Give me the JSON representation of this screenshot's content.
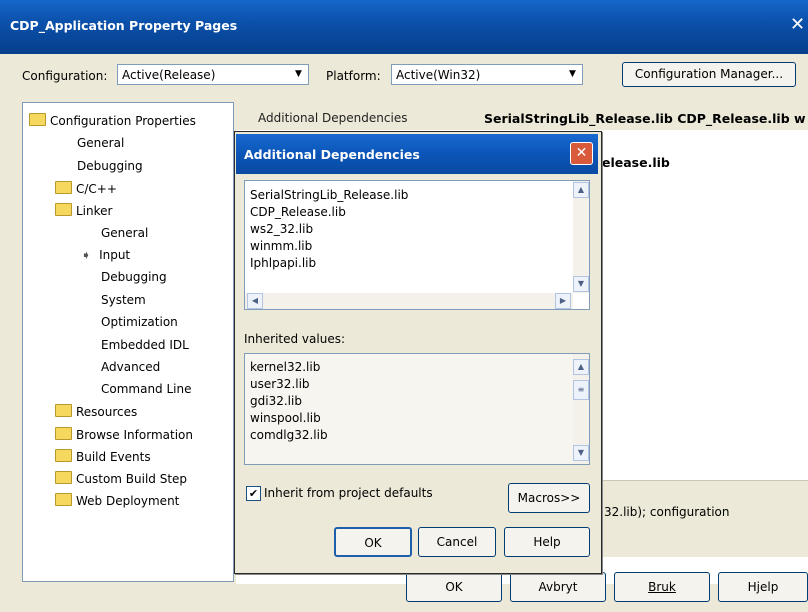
{
  "window": {
    "title": "CDP_Application Property Pages",
    "close_glyph": "✕"
  },
  "toolbar": {
    "configuration_label": "Configuration:",
    "configuration_value": "Active(Release)",
    "platform_label": "Platform:",
    "platform_value": "Active(Win32)",
    "config_manager_label": "Configuration Manager..."
  },
  "tree": {
    "items": [
      {
        "label": "Configuration Properties"
      },
      {
        "label": "General"
      },
      {
        "label": "Debugging"
      },
      {
        "label": "C/C++"
      },
      {
        "label": "Linker"
      },
      {
        "label": "General"
      },
      {
        "label": "Input"
      },
      {
        "label": "Debugging"
      },
      {
        "label": "System"
      },
      {
        "label": "Optimization"
      },
      {
        "label": "Embedded IDL"
      },
      {
        "label": "Advanced"
      },
      {
        "label": "Command Line"
      },
      {
        "label": "Resources"
      },
      {
        "label": "Browse Information"
      },
      {
        "label": "Build Events"
      },
      {
        "label": "Custom Build Step"
      },
      {
        "label": "Web Deployment"
      }
    ]
  },
  "grid": {
    "row0_name": "Additional Dependencies",
    "row0_value": "SerialStringLib_Release.lib CDP_Release.lib w",
    "row1_value": "elease.lib"
  },
  "description": {
    "text": "32.lib); configuration"
  },
  "footer": {
    "ok": "OK",
    "cancel": "Avbryt",
    "apply": "Bruk",
    "help": "Hjelp"
  },
  "dialog": {
    "title": "Additional Dependencies",
    "close_glyph": "✕",
    "deps": [
      "SerialStringLib_Release.lib",
      "CDP_Release.lib",
      "ws2_32.lib",
      "winmm.lib",
      "Iphlpapi.lib"
    ],
    "inherited_label": "Inherited values:",
    "inherited": [
      "kernel32.lib",
      "user32.lib",
      "gdi32.lib",
      "winspool.lib",
      "comdlg32.lib"
    ],
    "inherit_checkbox_label": "Inherit from project defaults",
    "inherit_checked": true,
    "macros": "Macros>>",
    "ok": "OK",
    "cancel": "Cancel",
    "help": "Help"
  }
}
